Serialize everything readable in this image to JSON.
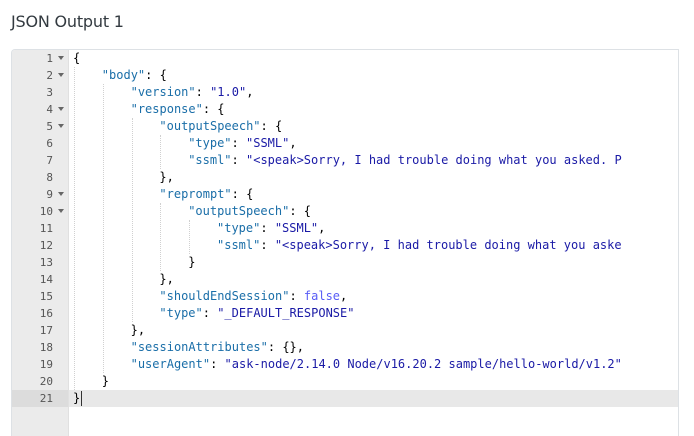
{
  "panel": {
    "title": "JSON Output 1"
  },
  "editor": {
    "active_line": 21,
    "lines": [
      {
        "n": "1",
        "fold": true,
        "indent": 0,
        "tokens": [
          [
            "p",
            "{"
          ]
        ]
      },
      {
        "n": "2",
        "fold": true,
        "indent": 1,
        "tokens": [
          [
            "key",
            "\"body\""
          ],
          [
            "p",
            ": {"
          ]
        ]
      },
      {
        "n": "3",
        "fold": false,
        "indent": 2,
        "tokens": [
          [
            "key",
            "\"version\""
          ],
          [
            "p",
            ": "
          ],
          [
            "str",
            "\"1.0\""
          ],
          [
            "p",
            ","
          ]
        ]
      },
      {
        "n": "4",
        "fold": true,
        "indent": 2,
        "tokens": [
          [
            "key",
            "\"response\""
          ],
          [
            "p",
            ": {"
          ]
        ]
      },
      {
        "n": "5",
        "fold": true,
        "indent": 3,
        "tokens": [
          [
            "key",
            "\"outputSpeech\""
          ],
          [
            "p",
            ": {"
          ]
        ]
      },
      {
        "n": "6",
        "fold": false,
        "indent": 4,
        "tokens": [
          [
            "key",
            "\"type\""
          ],
          [
            "p",
            ": "
          ],
          [
            "str",
            "\"SSML\""
          ],
          [
            "p",
            ","
          ]
        ]
      },
      {
        "n": "7",
        "fold": false,
        "indent": 4,
        "tokens": [
          [
            "key",
            "\"ssml\""
          ],
          [
            "p",
            ": "
          ],
          [
            "str",
            "\"<speak>Sorry, I had trouble doing what you asked. P"
          ]
        ]
      },
      {
        "n": "8",
        "fold": false,
        "indent": 3,
        "tokens": [
          [
            "p",
            "},"
          ]
        ]
      },
      {
        "n": "9",
        "fold": true,
        "indent": 3,
        "tokens": [
          [
            "key",
            "\"reprompt\""
          ],
          [
            "p",
            ": {"
          ]
        ]
      },
      {
        "n": "10",
        "fold": true,
        "indent": 4,
        "tokens": [
          [
            "key",
            "\"outputSpeech\""
          ],
          [
            "p",
            ": {"
          ]
        ]
      },
      {
        "n": "11",
        "fold": false,
        "indent": 5,
        "tokens": [
          [
            "key",
            "\"type\""
          ],
          [
            "p",
            ": "
          ],
          [
            "str",
            "\"SSML\""
          ],
          [
            "p",
            ","
          ]
        ]
      },
      {
        "n": "12",
        "fold": false,
        "indent": 5,
        "tokens": [
          [
            "key",
            "\"ssml\""
          ],
          [
            "p",
            ": "
          ],
          [
            "str",
            "\"<speak>Sorry, I had trouble doing what you aske"
          ]
        ]
      },
      {
        "n": "13",
        "fold": false,
        "indent": 4,
        "tokens": [
          [
            "p",
            "}"
          ]
        ]
      },
      {
        "n": "14",
        "fold": false,
        "indent": 3,
        "tokens": [
          [
            "p",
            "},"
          ]
        ]
      },
      {
        "n": "15",
        "fold": false,
        "indent": 3,
        "tokens": [
          [
            "key",
            "\"shouldEndSession\""
          ],
          [
            "p",
            ": "
          ],
          [
            "bool",
            "false"
          ],
          [
            "p",
            ","
          ]
        ]
      },
      {
        "n": "16",
        "fold": false,
        "indent": 3,
        "tokens": [
          [
            "key",
            "\"type\""
          ],
          [
            "p",
            ": "
          ],
          [
            "str",
            "\"_DEFAULT_RESPONSE\""
          ]
        ]
      },
      {
        "n": "17",
        "fold": false,
        "indent": 2,
        "tokens": [
          [
            "p",
            "},"
          ]
        ]
      },
      {
        "n": "18",
        "fold": false,
        "indent": 2,
        "tokens": [
          [
            "key",
            "\"sessionAttributes\""
          ],
          [
            "p",
            ": {},"
          ]
        ]
      },
      {
        "n": "19",
        "fold": false,
        "indent": 2,
        "tokens": [
          [
            "key",
            "\"userAgent\""
          ],
          [
            "p",
            ": "
          ],
          [
            "str",
            "\"ask-node/2.14.0 Node/v16.20.2 sample/hello-world/v1.2\""
          ]
        ]
      },
      {
        "n": "20",
        "fold": false,
        "indent": 1,
        "tokens": [
          [
            "p",
            "}"
          ]
        ]
      },
      {
        "n": "21",
        "fold": false,
        "indent": 0,
        "tokens": [
          [
            "p",
            "}"
          ]
        ]
      }
    ]
  }
}
